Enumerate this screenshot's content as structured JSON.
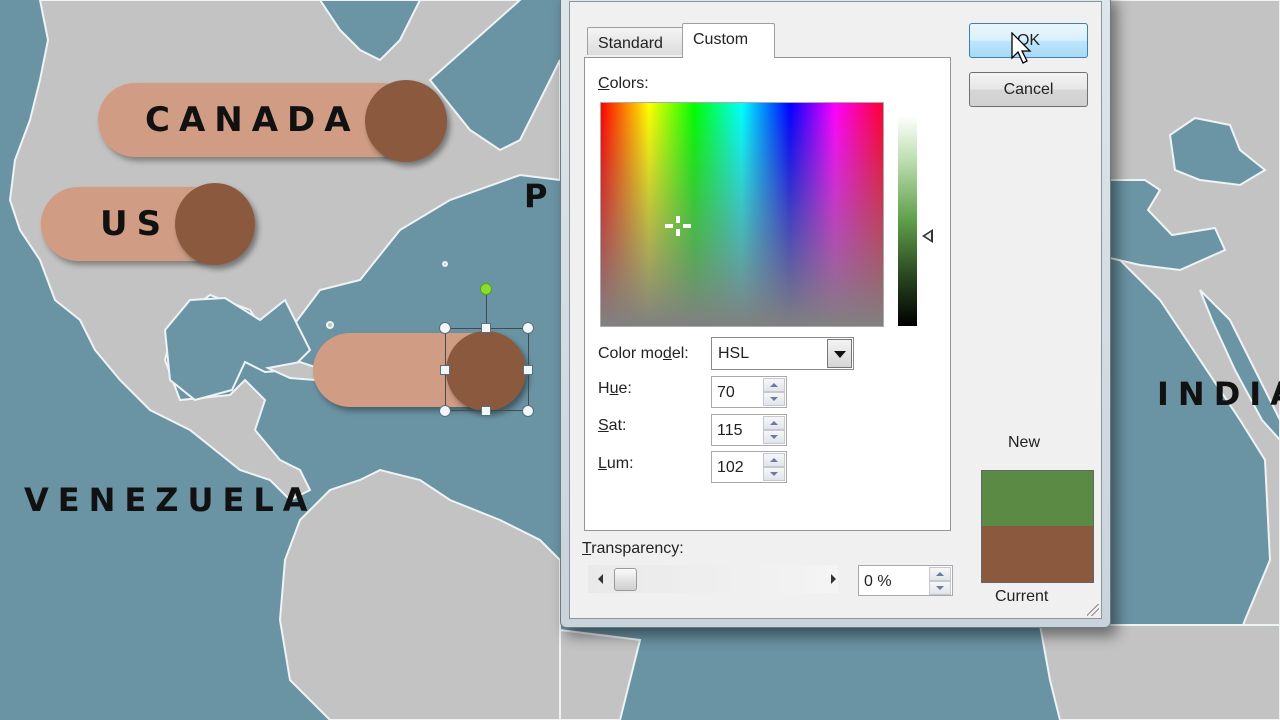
{
  "map": {
    "labels": {
      "venezuela": "VENEZUELA",
      "india": "INDIA",
      "partial_label": "P"
    },
    "callouts": [
      {
        "label": "CANADA",
        "pill_color": "#d09d84",
        "dot_color": "#8b5a3e"
      },
      {
        "label": "US",
        "pill_color": "#d09d84",
        "dot_color": "#8b5a3e"
      },
      {
        "label": "",
        "pill_color": "#d09d84",
        "dot_color": "#8b5a3e",
        "selected": true
      }
    ],
    "colors": {
      "land": "#c3c3c3",
      "sea": "#6b94a4"
    }
  },
  "dialog": {
    "tabs": [
      {
        "label": "Standard",
        "active": false
      },
      {
        "label": "Custom",
        "active": true
      }
    ],
    "colors_label_prefix": "C",
    "colors_label_rest": "olors:",
    "color_model": {
      "label_a": "Color mo",
      "label_u": "d",
      "label_b": "el:",
      "value": "HSL"
    },
    "fields": [
      {
        "label_a": "H",
        "label_u": "u",
        "label_b": "e:",
        "value": "70"
      },
      {
        "label_a": "",
        "label_u": "S",
        "label_b": "at:",
        "value": "115"
      },
      {
        "label_a": "",
        "label_u": "L",
        "label_b": "um:",
        "value": "102"
      }
    ],
    "transparency": {
      "label_u": "T",
      "label_rest": "ransparency:",
      "value": "0 %",
      "percent": 0
    },
    "buttons": {
      "ok": "OK",
      "cancel": "Cancel"
    },
    "preview": {
      "new_label": "New",
      "current_label": "Current",
      "new_color": "#5a8a44",
      "current_color": "#8b5a3e"
    }
  }
}
